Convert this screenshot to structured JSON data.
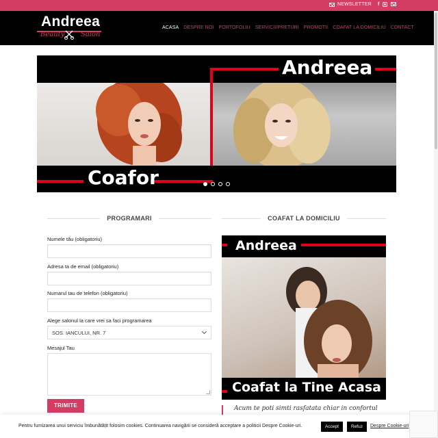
{
  "topbar": {
    "newsletter_label": "NEWSLETTER",
    "icons": [
      "facebook-icon",
      "instagram-icon",
      "mail-icon"
    ]
  },
  "logo": {
    "name": "Andreea",
    "sub_left": "Beauty",
    "sub_right": "Salon"
  },
  "nav": {
    "items": [
      "ACASA",
      "DESPRE NOI",
      "PORTOFOLIU",
      "SERVICII/PRETURI",
      "PROMOTII",
      "COAFAT LA DOMICILIU",
      "CONTACT"
    ],
    "active": "ACASA"
  },
  "slider": {
    "title_top": "Andreea",
    "title_bottom": "Coafor",
    "dot_count": 4,
    "active_dot": 1
  },
  "left_section": {
    "heading": "PROGRAMARI",
    "fields": {
      "name_label": "Numele tău (obligatoriu)",
      "email_label": "Adresa ta de email (obligatoriu)",
      "phone_label": "Numarul tau de telefon (obligatoriu)",
      "salon_label": "Alege salonul la care vrei sa faci programarea",
      "salon_value": "SOS. IANCULUI, NR. 7",
      "message_label": "Mesajul Tau"
    },
    "submit_label": "TRIMITE"
  },
  "right_section": {
    "heading": "COAFAT LA DOMICILIU",
    "promo_top": "Andreea",
    "promo_bottom": "Coafat la Tine Acasa",
    "quote": "Acum te poti simti rasfatata chiar in confortul"
  },
  "cookie_bar": {
    "message": "Pentru furnizarea unui serviciu îmbunătățit folosim cookies. Continuarea navigării se consideră acceptare a politicii Despre Cookie-uri.",
    "accept_label": "Accept",
    "refuse_label": "Refuz",
    "link_label": "Despre Cookie-uri"
  },
  "colors": {
    "brand": "#d43d63",
    "header_bg": "#000000",
    "slider_red": "#e2001a"
  }
}
